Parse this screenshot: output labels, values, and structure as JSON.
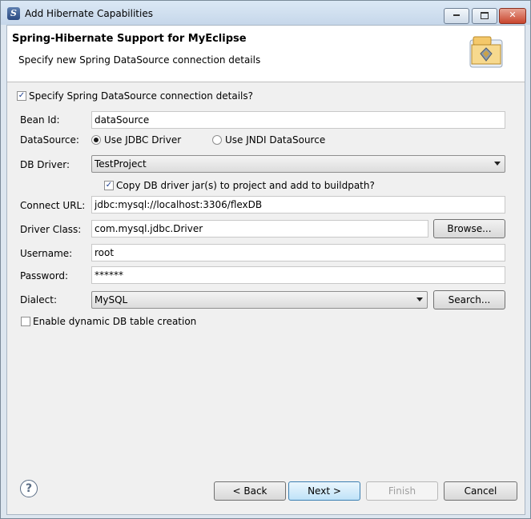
{
  "window": {
    "title": "Add Hibernate Capabilities",
    "minimize_icon": "minimize-icon",
    "maximize_icon": "maximize-icon",
    "close_icon": "close-icon"
  },
  "banner": {
    "title": "Spring-Hibernate Support for MyEclipse",
    "subtitle": "Specify new Spring DataSource connection details"
  },
  "form": {
    "specify_checkbox": {
      "label": "Specify Spring DataSource connection details?",
      "checked": true
    },
    "bean_id": {
      "label": "Bean Id:",
      "value": "dataSource"
    },
    "datasource": {
      "label": "DataSource:",
      "options": [
        {
          "label": "Use JDBC Driver",
          "selected": true
        },
        {
          "label": "Use JNDI DataSource",
          "selected": false
        }
      ]
    },
    "db_driver": {
      "label": "DB Driver:",
      "value": "TestProject"
    },
    "copy_jars": {
      "label": "Copy DB driver jar(s) to project and add to buildpath?",
      "checked": true
    },
    "connect_url": {
      "label": "Connect URL:",
      "value": "jdbc:mysql://localhost:3306/flexDB"
    },
    "driver_class": {
      "label": "Driver Class:",
      "value": "com.mysql.jdbc.Driver",
      "browse_label": "Browse..."
    },
    "username": {
      "label": "Username:",
      "value": "root"
    },
    "password": {
      "label": "Password:",
      "value": "******"
    },
    "dialect": {
      "label": "Dialect:",
      "value": "MySQL",
      "search_label": "Search..."
    },
    "dynamic_table": {
      "label": "Enable dynamic DB table creation",
      "checked": false
    }
  },
  "footer": {
    "help_icon": "help-icon",
    "back_label": "< Back",
    "next_label": "Next >",
    "finish_label": "Finish",
    "cancel_label": "Cancel"
  }
}
